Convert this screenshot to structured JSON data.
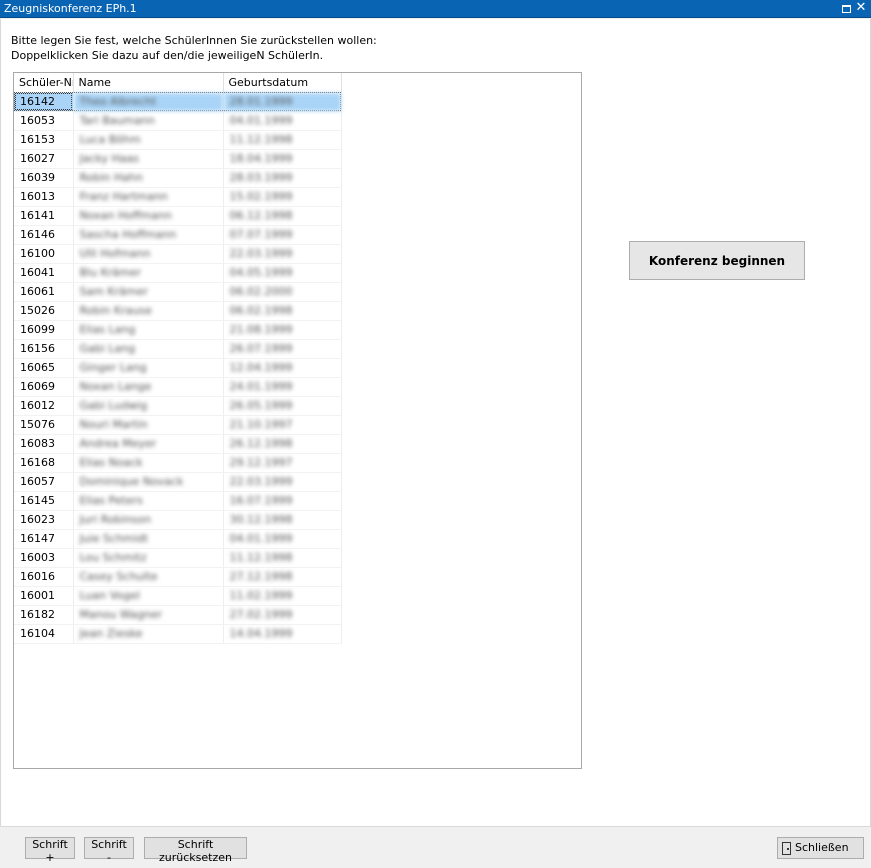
{
  "window": {
    "title": "Zeugniskonferenz EPh.1",
    "maximize_glyph": "",
    "close_glyph": "✕"
  },
  "instructions": {
    "line1": "Bitte legen Sie fest, welche SchülerInnen Sie zurückstellen wollen:",
    "line2": "Doppelklicken Sie dazu auf den/die jeweiligeN SchülerIn."
  },
  "table": {
    "headers": {
      "id": "Schüler-Nr",
      "name": "Name",
      "birthdate": "Geburtsdatum"
    },
    "selected_index": 0,
    "rows": [
      {
        "id": "16142",
        "name": "Theo Albrecht",
        "birthdate": "28.01.1999"
      },
      {
        "id": "16053",
        "name": "Tari Baumann",
        "birthdate": "04.01.1999"
      },
      {
        "id": "16153",
        "name": "Luca Böhm",
        "birthdate": "11.12.1998"
      },
      {
        "id": "16027",
        "name": "Jacky Haas",
        "birthdate": "18.04.1999"
      },
      {
        "id": "16039",
        "name": "Robin Hahn",
        "birthdate": "28.03.1999"
      },
      {
        "id": "16013",
        "name": "Franz Hartmann",
        "birthdate": "15.02.1999"
      },
      {
        "id": "16141",
        "name": "Noxan Hoffmann",
        "birthdate": "06.12.1998"
      },
      {
        "id": "16146",
        "name": "Sascha Hoffmann",
        "birthdate": "07.07.1999"
      },
      {
        "id": "16100",
        "name": "Ulli Hofmann",
        "birthdate": "22.03.1999"
      },
      {
        "id": "16041",
        "name": "Blu Krämer",
        "birthdate": "04.05.1999"
      },
      {
        "id": "16061",
        "name": "Sam Krämer",
        "birthdate": "06.02.2000"
      },
      {
        "id": "15026",
        "name": "Robin Krause",
        "birthdate": "06.02.1998"
      },
      {
        "id": "16099",
        "name": "Elias Lang",
        "birthdate": "21.08.1999"
      },
      {
        "id": "16156",
        "name": "Gabi Lang",
        "birthdate": "26.07.1999"
      },
      {
        "id": "16065",
        "name": "Ginger Lang",
        "birthdate": "12.04.1999"
      },
      {
        "id": "16069",
        "name": "Noxan Lange",
        "birthdate": "24.01.1999"
      },
      {
        "id": "16012",
        "name": "Gabi Ludwig",
        "birthdate": "26.05.1999"
      },
      {
        "id": "15076",
        "name": "Nouri Martin",
        "birthdate": "21.10.1997"
      },
      {
        "id": "16083",
        "name": "Andrea Meyer",
        "birthdate": "26.12.1998"
      },
      {
        "id": "16168",
        "name": "Elias Noack",
        "birthdate": "29.12.1997"
      },
      {
        "id": "16057",
        "name": "Dominique Novack",
        "birthdate": "22.03.1999"
      },
      {
        "id": "16145",
        "name": "Elias Peters",
        "birthdate": "16.07.1999"
      },
      {
        "id": "16023",
        "name": "Juri Robinson",
        "birthdate": "30.12.1998"
      },
      {
        "id": "16147",
        "name": "Juie Schmidt",
        "birthdate": "04.01.1999"
      },
      {
        "id": "16003",
        "name": "Lou Schmitz",
        "birthdate": "11.12.1998"
      },
      {
        "id": "16016",
        "name": "Casey Schulte",
        "birthdate": "27.12.1998"
      },
      {
        "id": "16001",
        "name": "Luan Vogel",
        "birthdate": "11.02.1999"
      },
      {
        "id": "16182",
        "name": "Manou Wagner",
        "birthdate": "27.02.1999"
      },
      {
        "id": "16104",
        "name": "Jean Zieske",
        "birthdate": "14.04.1999"
      }
    ]
  },
  "actions": {
    "begin_conference": "Konferenz beginnen"
  },
  "footer": {
    "font_plus": "Schrift +",
    "font_minus": "Schrift -",
    "font_reset": "Schrift zurücksetzen",
    "close": "Schließen"
  }
}
